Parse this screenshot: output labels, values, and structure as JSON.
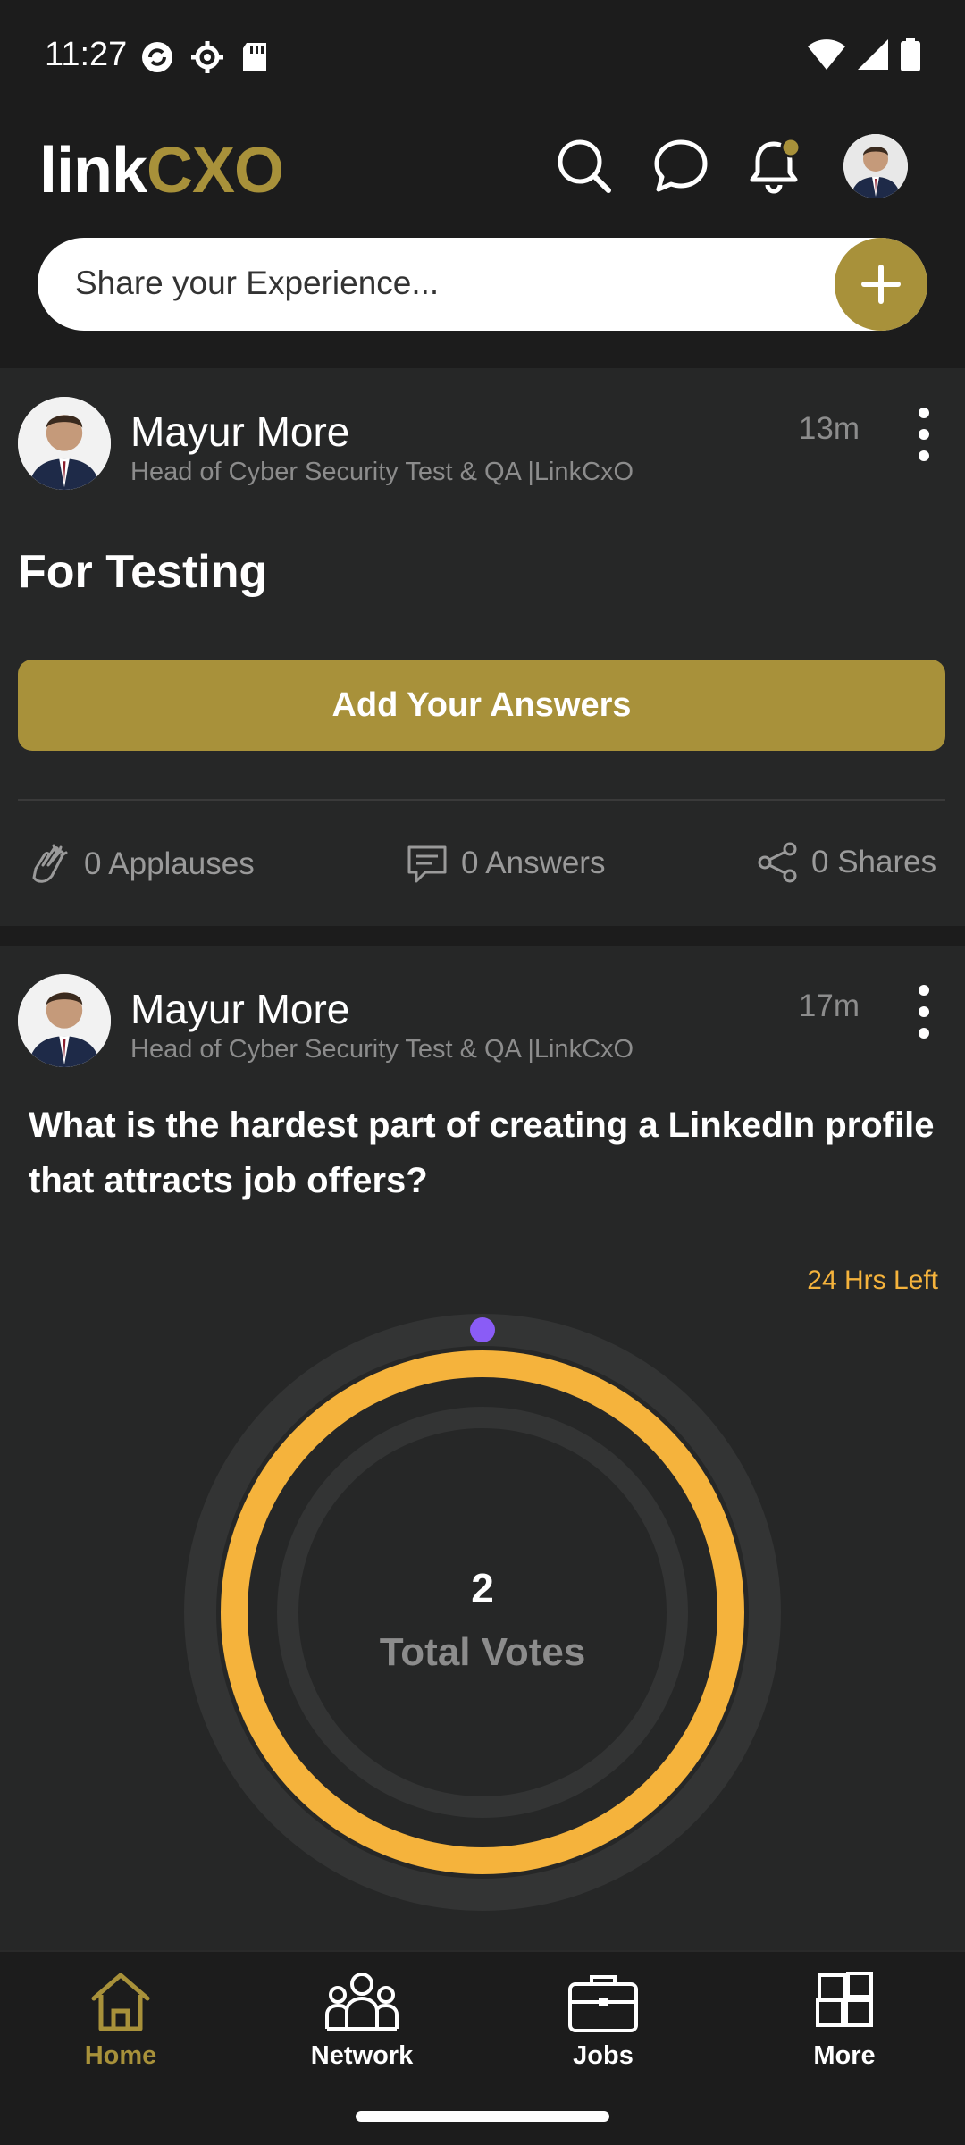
{
  "status_bar": {
    "time": "11:27"
  },
  "app_bar": {
    "logo_link": "link",
    "logo_cxo": "CXO",
    "accent_color": "#a8913a"
  },
  "share": {
    "placeholder": "Share your Experience..."
  },
  "post1": {
    "author": "Mayur More",
    "author_title": "Head of Cyber Security Test & QA |LinkCxO",
    "time": "13m",
    "heading": "For Testing",
    "answer_button": "Add Your Answers",
    "applauses": "0 Applauses",
    "answers": "0 Answers",
    "shares": "0 Shares"
  },
  "post2": {
    "author": "Mayur More",
    "author_title": "Head of Cyber Security Test & QA |LinkCxO",
    "time": "17m",
    "question": "What is the hardest part of creating a LinkedIn profile that attracts job offers?",
    "time_left": "24 Hrs Left",
    "total_votes": "2",
    "total_votes_label": "Total Votes",
    "poll_color": "#f5b33c",
    "marker_color": "#8a5cf6"
  },
  "bottom_nav": {
    "items": [
      {
        "label": "Home",
        "active": true
      },
      {
        "label": "Network",
        "active": false
      },
      {
        "label": "Jobs",
        "active": false
      },
      {
        "label": "More",
        "active": false
      }
    ]
  }
}
